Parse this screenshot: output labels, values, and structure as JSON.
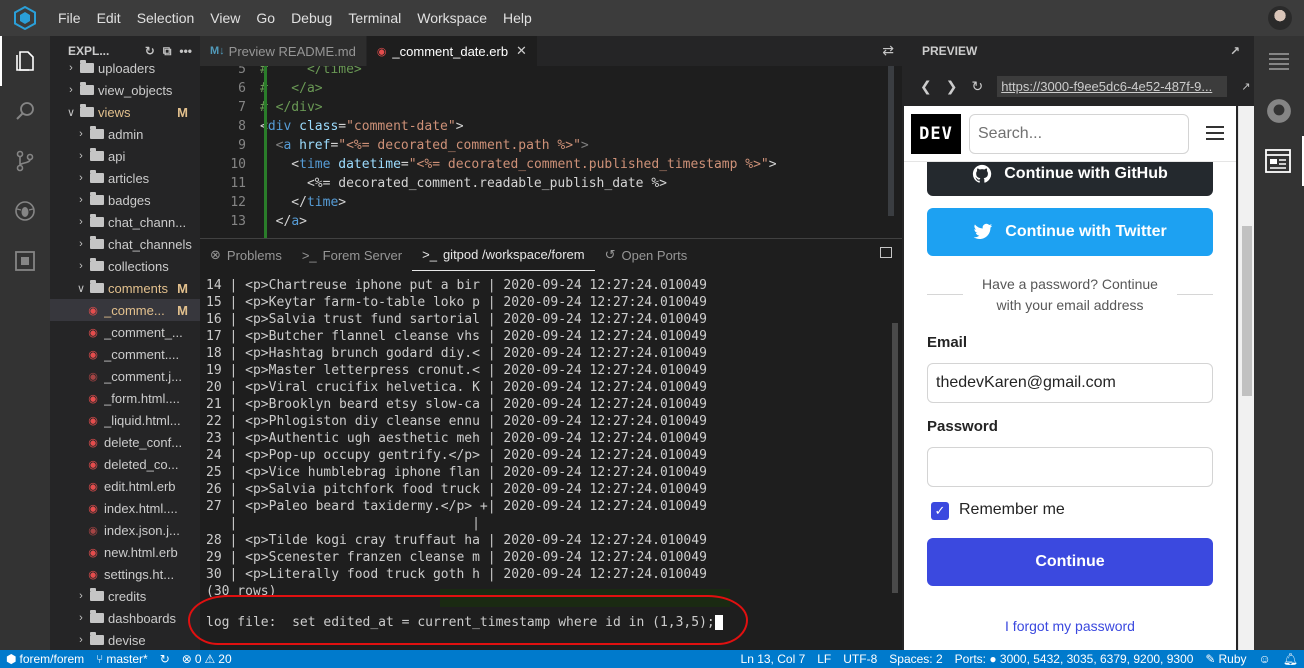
{
  "menu": [
    "File",
    "Edit",
    "Selection",
    "View",
    "Go",
    "Debug",
    "Terminal",
    "Workspace",
    "Help"
  ],
  "explorer": {
    "title": "EXPL...",
    "items": [
      {
        "label": "uploaders",
        "type": "folder",
        "indent": 1,
        "open": false,
        "mod": ""
      },
      {
        "label": "view_objects",
        "type": "folder",
        "indent": 1,
        "open": false,
        "mod": ""
      },
      {
        "label": "views",
        "type": "folder",
        "indent": 1,
        "open": true,
        "mod": "M"
      },
      {
        "label": "admin",
        "type": "folder",
        "indent": 2,
        "open": false,
        "mod": ""
      },
      {
        "label": "api",
        "type": "folder",
        "indent": 2,
        "open": false,
        "mod": ""
      },
      {
        "label": "articles",
        "type": "folder",
        "indent": 2,
        "open": false,
        "mod": ""
      },
      {
        "label": "badges",
        "type": "folder",
        "indent": 2,
        "open": false,
        "mod": ""
      },
      {
        "label": "chat_chann...",
        "type": "folder",
        "indent": 2,
        "open": false,
        "mod": ""
      },
      {
        "label": "chat_channels",
        "type": "folder",
        "indent": 2,
        "open": false,
        "mod": ""
      },
      {
        "label": "collections",
        "type": "folder",
        "indent": 2,
        "open": false,
        "mod": ""
      },
      {
        "label": "comments",
        "type": "folder",
        "indent": 2,
        "open": true,
        "mod": "M"
      },
      {
        "label": "_comme...",
        "type": "file",
        "indent": 3,
        "selected": true,
        "mod": "M"
      },
      {
        "label": "_comment_...",
        "type": "file",
        "indent": 3,
        "mod": ""
      },
      {
        "label": "_comment....",
        "type": "file",
        "indent": 3,
        "mod": ""
      },
      {
        "label": "_comment.j...",
        "type": "file-dim",
        "indent": 3,
        "mod": ""
      },
      {
        "label": "_form.html....",
        "type": "file",
        "indent": 3,
        "mod": ""
      },
      {
        "label": "_liquid.html...",
        "type": "file",
        "indent": 3,
        "mod": ""
      },
      {
        "label": "delete_conf...",
        "type": "file",
        "indent": 3,
        "mod": ""
      },
      {
        "label": "deleted_co...",
        "type": "file",
        "indent": 3,
        "mod": ""
      },
      {
        "label": "edit.html.erb",
        "type": "file",
        "indent": 3,
        "mod": ""
      },
      {
        "label": "index.html....",
        "type": "file",
        "indent": 3,
        "mod": ""
      },
      {
        "label": "index.json.j...",
        "type": "file-dim",
        "indent": 3,
        "mod": ""
      },
      {
        "label": "new.html.erb",
        "type": "file",
        "indent": 3,
        "mod": ""
      },
      {
        "label": "settings.ht...",
        "type": "file",
        "indent": 3,
        "mod": ""
      },
      {
        "label": "credits",
        "type": "folder",
        "indent": 2,
        "open": false,
        "mod": ""
      },
      {
        "label": "dashboards",
        "type": "folder",
        "indent": 2,
        "open": false,
        "mod": ""
      },
      {
        "label": "devise",
        "type": "folder",
        "indent": 2,
        "open": false,
        "mod": ""
      }
    ]
  },
  "tabs": [
    {
      "label": "Preview README.md",
      "icon": "MI",
      "active": false
    },
    {
      "label": "_comment_date.erb",
      "icon": "erb",
      "active": true
    }
  ],
  "code": [
    {
      "n": "5",
      "html": "<span class=\"cm\">#     &lt;/time&gt;</span>"
    },
    {
      "n": "6",
      "html": "<span class=\"cm\">#   &lt;/a&gt;</span>"
    },
    {
      "n": "7",
      "html": "<span class=\"cm\"># &lt;/div&gt;</span>"
    },
    {
      "n": "8",
      "html": "&lt;<span class=\"tag\">div</span> <span class=\"attr\">class</span>=<span class=\"str\">\"comment-date\"</span>&gt;"
    },
    {
      "n": "9",
      "html": "  <span class=\"gray\">&lt;</span><span class=\"tag\">a</span> <span class=\"attr\">href</span>=<span class=\"str\">\"&lt;%= decorated_comment.path %&gt;\"</span><span class=\"gray\">&gt;</span>"
    },
    {
      "n": "10",
      "html": "    &lt;<span class=\"tag\">time</span> <span class=\"attr\">datetime</span>=<span class=\"str\">\"&lt;%= decorated_comment.published_timestamp %&gt;\"</span>&gt;"
    },
    {
      "n": "11",
      "html": "      &lt;%= decorated_comment.readable_publish_date %&gt;"
    },
    {
      "n": "12",
      "html": "    &lt;/<span class=\"tag\">time</span>&gt;"
    },
    {
      "n": "13",
      "html": "  &lt;/<span class=\"tag\">a</span>&gt;"
    }
  ],
  "panel": {
    "tabs": [
      "Problems",
      "Forem Server",
      "gitpod /workspace/forem",
      "Open Ports"
    ],
    "active_tab": 2,
    "rows": [
      "14 | <p>Chartreuse iphone put a bir | 2020-09-24 12:27:24.010049",
      "15 | <p>Keytar farm-to-table loko p | 2020-09-24 12:27:24.010049",
      "16 | <p>Salvia trust fund sartorial | 2020-09-24 12:27:24.010049",
      "17 | <p>Butcher flannel cleanse vhs | 2020-09-24 12:27:24.010049",
      "18 | <p>Hashtag brunch godard diy.< | 2020-09-24 12:27:24.010049",
      "19 | <p>Master letterpress cronut.< | 2020-09-24 12:27:24.010049",
      "20 | <p>Viral crucifix helvetica. K | 2020-09-24 12:27:24.010049",
      "21 | <p>Brooklyn beard etsy slow-ca | 2020-09-24 12:27:24.010049",
      "22 | <p>Phlogiston diy cleanse ennu | 2020-09-24 12:27:24.010049",
      "23 | <p>Authentic ugh aesthetic meh | 2020-09-24 12:27:24.010049",
      "24 | <p>Pop-up occupy gentrify.</p> | 2020-09-24 12:27:24.010049",
      "25 | <p>Vice humblebrag iphone flan | 2020-09-24 12:27:24.010049",
      "26 | <p>Salvia pitchfork food truck | 2020-09-24 12:27:24.010049",
      "27 | <p>Paleo beard taxidermy.</p> +| 2020-09-24 12:27:24.010049",
      "   |                              |",
      "28 | <p>Tilde kogi cray truffaut ha | 2020-09-24 12:27:24.010049",
      "29 | <p>Scenester franzen cleanse m | 2020-09-24 12:27:24.010049",
      "30 | <p>Literally food truck goth h | 2020-09-24 12:27:24.010049",
      "(30 rows)"
    ],
    "prompt": "log file:  set edited_at = current_timestamp where id in (1,3,5);"
  },
  "preview": {
    "title": "PREVIEW",
    "url": "https://3000-f9ee5dc6-4e52-487f-9...",
    "logo": "DEV",
    "search_placeholder": "Search...",
    "github_btn": "Continue with GitHub",
    "twitter_btn": "Continue with Twitter",
    "divider_text": "Have a password? Continue with your email address",
    "email_label": "Email",
    "email_value": "thedevKaren@gmail.com",
    "password_label": "Password",
    "remember": "Remember me",
    "continue_btn": "Continue",
    "forgot": "I forgot my password"
  },
  "status": {
    "repo": "forem/forem",
    "branch": "master*",
    "errors": "0",
    "warnings": "20",
    "position": "Ln 13, Col 7",
    "eol": "LF",
    "encoding": "UTF-8",
    "spaces": "Spaces: 2",
    "ports": "Ports: ● 3000, 5432, 3035, 6379, 9200, 9300",
    "language": "Ruby"
  },
  "colors": {
    "status_bar": "#007acc",
    "dev_primary": "#3b49df",
    "twitter": "#1da1f2",
    "github": "#24292e",
    "annotation": "#e01010"
  }
}
